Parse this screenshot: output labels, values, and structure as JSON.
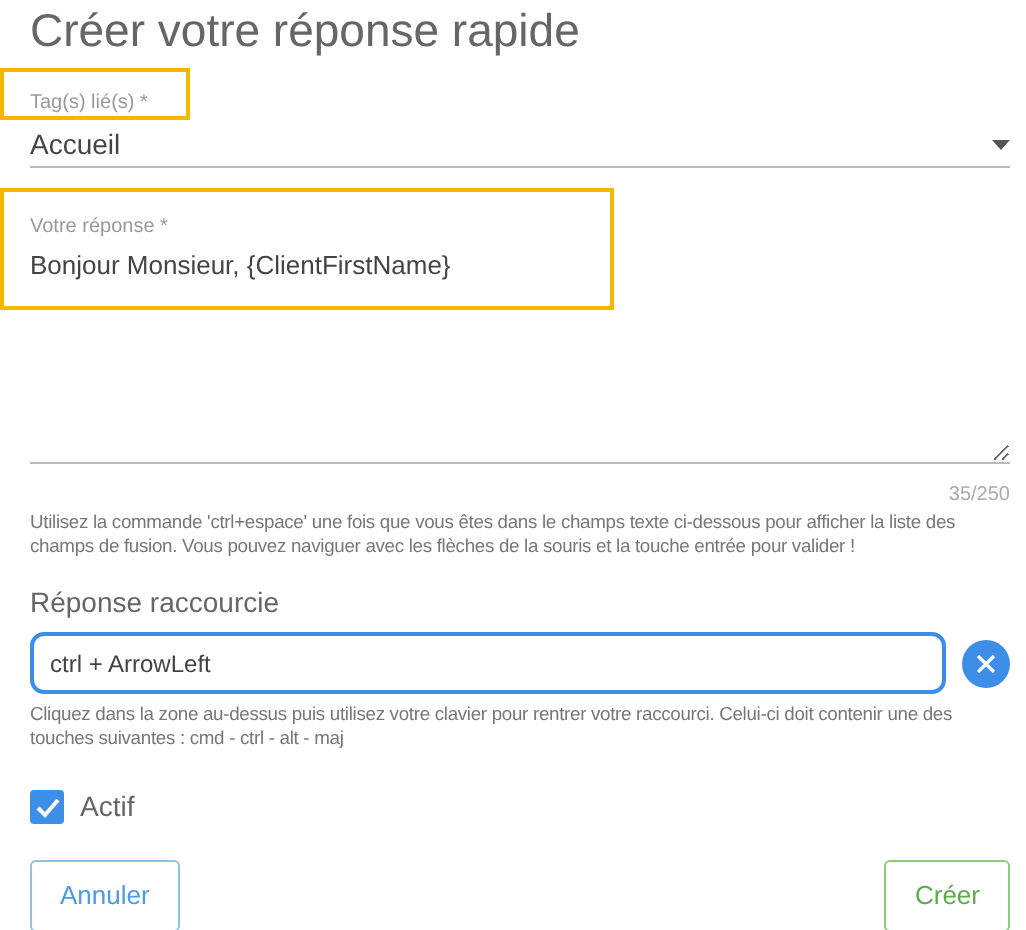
{
  "title": "Créer votre réponse rapide",
  "tags_field": {
    "label": "Tag(s) lié(s) *",
    "value": "Accueil",
    "highlighted": true
  },
  "response_field": {
    "label": "Votre réponse *",
    "value": "Bonjour Monsieur, {ClientFirstName}",
    "highlighted": true,
    "counter": "35/250",
    "help": "Utilisez la commande 'ctrl+espace' une fois que vous êtes dans le champs texte ci-dessous pour afficher la liste des champs de fusion. Vous pouvez naviguer avec les flèches de la souris et la touche entrée pour valider !"
  },
  "shortcut_field": {
    "label": "Réponse raccourcie",
    "value": "ctrl + ArrowLeft",
    "help": "Cliquez dans la zone au-dessus puis utilisez votre clavier pour rentrer votre raccourci. Celui-ci doit contenir une des touches suivantes : cmd - ctrl - alt - maj"
  },
  "active": {
    "label": "Actif",
    "checked": true
  },
  "buttons": [
    {
      "label": "Annuler",
      "kind": "cancel"
    },
    {
      "label": "Créer",
      "kind": "create"
    }
  ]
}
